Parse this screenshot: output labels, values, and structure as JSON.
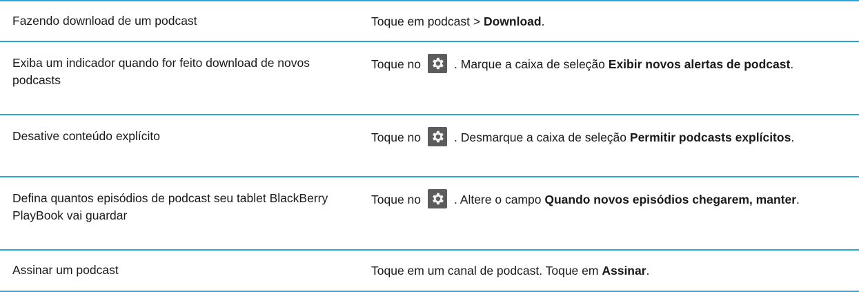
{
  "rows": [
    {
      "task": "Fazendo download de um podcast",
      "pre": "Toque em podcast > ",
      "bold": "Download",
      "post": "."
    },
    {
      "task": "Exiba um indicador quando for feito download de novos podcasts",
      "pre": "Toque no",
      "mid": ". Marque a caixa de seleção ",
      "bold": "Exibir novos alertas de podcast",
      "post": "."
    },
    {
      "task": "Desative conteúdo explícito",
      "pre": "Toque no",
      "mid": ". Desmarque a caixa de seleção ",
      "bold": "Permitir podcasts explícitos",
      "post": "."
    },
    {
      "task": "Defina quantos episódios de podcast seu tablet BlackBerry PlayBook vai guardar",
      "pre": "Toque no",
      "mid": ". Altere o campo ",
      "bold": "Quando novos episódios chegarem, manter",
      "post": "."
    },
    {
      "task": "Assinar um podcast",
      "pre": "Toque em um canal de podcast. Toque em ",
      "bold": "Assinar",
      "post": "."
    }
  ],
  "icons": {
    "settings": "gear-icon"
  },
  "colors": {
    "rule": "#2aa6dc",
    "icon_bg": "#5c5c5c"
  }
}
